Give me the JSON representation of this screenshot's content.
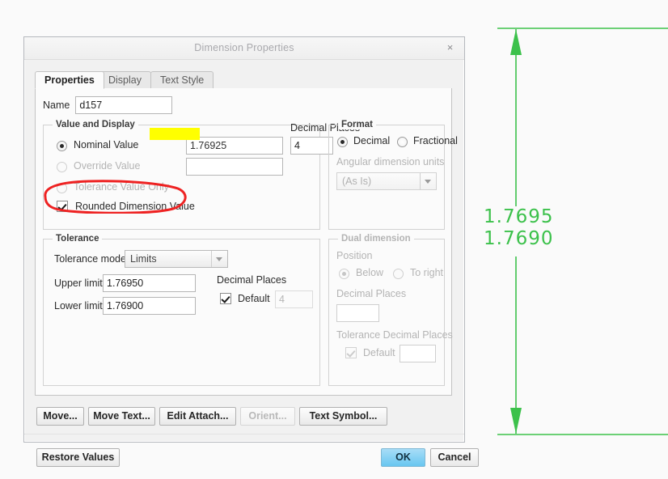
{
  "window": {
    "title": "Dimension Properties",
    "close_label": "×"
  },
  "tabs": [
    {
      "label": "Properties",
      "active": true
    },
    {
      "label": "Display",
      "active": false
    },
    {
      "label": "Text Style",
      "active": false
    }
  ],
  "name_row": {
    "label": "Name",
    "value": "d157"
  },
  "value_and_display": {
    "title": "Value and Display",
    "nominal_value_label": "Nominal Value",
    "nominal_value": "1.76925",
    "nominal_value_selected": true,
    "override_value_label": "Override Value",
    "override_value": "",
    "tolerance_value_only_label": "Tolerance Value Only",
    "decimal_places_label": "Decimal Places",
    "decimal_places": "4",
    "rounded_dimension_value_label": "Rounded Dimension Value",
    "rounded_dimension_value_checked": true
  },
  "format": {
    "title": "Format",
    "decimal_label": "Decimal",
    "fractional_label": "Fractional",
    "selected": "Decimal",
    "angular_units_label": "Angular dimension units",
    "angular_units_value": "(As Is)"
  },
  "tolerance": {
    "title": "Tolerance",
    "mode_label": "Tolerance mode",
    "mode_value": "Limits",
    "upper_limit_label": "Upper limit",
    "upper_limit": "1.76950",
    "lower_limit_label": "Lower limit",
    "lower_limit": "1.76900",
    "decimal_places_label": "Decimal Places",
    "default_label": "Default",
    "default_checked": true,
    "default_decimal_places": "4"
  },
  "dual_dimension": {
    "title": "Dual dimension",
    "position_label": "Position",
    "below_label": "Below",
    "to_right_label": "To right",
    "selected": "Below",
    "decimal_places_label": "Decimal Places",
    "decimal_places": "",
    "tolerance_decimal_places_label": "Tolerance Decimal Places",
    "default_label": "Default",
    "default_checked": true,
    "default_value": ""
  },
  "action_buttons": [
    {
      "label": "Move...",
      "enabled": true
    },
    {
      "label": "Move Text...",
      "enabled": true
    },
    {
      "label": "Edit Attach...",
      "enabled": true
    },
    {
      "label": "Orient...",
      "enabled": false
    },
    {
      "label": "Text Symbol...",
      "enabled": true
    }
  ],
  "footer": {
    "restore_label": "Restore Values",
    "ok_label": "OK",
    "cancel_label": "Cancel"
  },
  "cad_annotation": {
    "upper_text": "1.7695",
    "lower_text": "1.7690",
    "color": "#3cc14b"
  },
  "markup": {
    "highlight_color": "#ffff00",
    "circle_color": "#ee2222"
  }
}
